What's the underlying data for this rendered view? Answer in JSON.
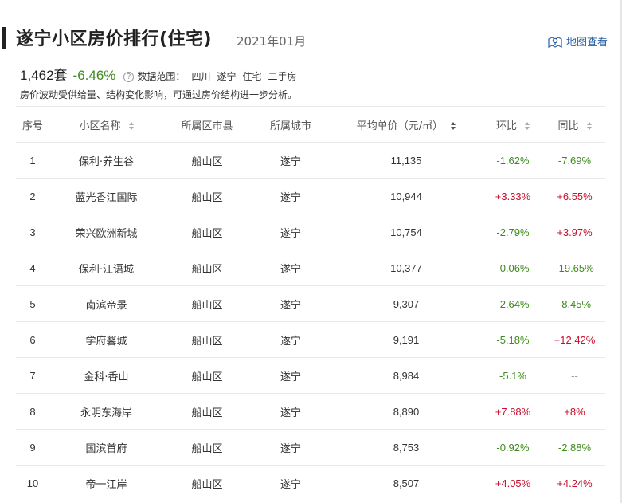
{
  "header": {
    "title": "遂宁小区房价排行(住宅)",
    "date": "2021年01月",
    "map_link": "地图查看"
  },
  "summary": {
    "count": "1,462套",
    "change": "-6.46%",
    "help_icon": "?",
    "scope_label": "数据范围：",
    "scope_items": [
      "四川",
      "遂宁",
      "住宅",
      "二手房"
    ],
    "note": "房价波动受供给量、结构变化影响，可通过房价结构进一步分析。"
  },
  "table": {
    "columns": [
      "序号",
      "小区名称",
      "所属区市县",
      "所属城市",
      "平均单价（元/㎡）",
      "环比",
      "同比"
    ],
    "rows": [
      {
        "rank": "1",
        "name": "保利·养生谷",
        "district": "船山区",
        "city": "遂宁",
        "price": "11,135",
        "mom": "-1.62%",
        "yoy": "-7.69%"
      },
      {
        "rank": "2",
        "name": "蓝光香江国际",
        "district": "船山区",
        "city": "遂宁",
        "price": "10,944",
        "mom": "+3.33%",
        "yoy": "+6.55%"
      },
      {
        "rank": "3",
        "name": "荣兴欧洲新城",
        "district": "船山区",
        "city": "遂宁",
        "price": "10,754",
        "mom": "-2.79%",
        "yoy": "+3.97%"
      },
      {
        "rank": "4",
        "name": "保利·江语城",
        "district": "船山区",
        "city": "遂宁",
        "price": "10,377",
        "mom": "-0.06%",
        "yoy": "-19.65%"
      },
      {
        "rank": "5",
        "name": "南滨帝景",
        "district": "船山区",
        "city": "遂宁",
        "price": "9,307",
        "mom": "-2.64%",
        "yoy": "-8.45%"
      },
      {
        "rank": "6",
        "name": "学府馨城",
        "district": "船山区",
        "city": "遂宁",
        "price": "9,191",
        "mom": "-5.18%",
        "yoy": "+12.42%"
      },
      {
        "rank": "7",
        "name": "金科·香山",
        "district": "船山区",
        "city": "遂宁",
        "price": "8,984",
        "mom": "-5.1%",
        "yoy": "--"
      },
      {
        "rank": "8",
        "name": "永明东海岸",
        "district": "船山区",
        "city": "遂宁",
        "price": "8,890",
        "mom": "+7.88%",
        "yoy": "+8%"
      },
      {
        "rank": "9",
        "name": "国滨首府",
        "district": "船山区",
        "city": "遂宁",
        "price": "8,753",
        "mom": "-0.92%",
        "yoy": "-2.88%"
      },
      {
        "rank": "10",
        "name": "帝一江岸",
        "district": "船山区",
        "city": "遂宁",
        "price": "8,507",
        "mom": "+4.05%",
        "yoy": "+4.24%"
      }
    ]
  },
  "colors": {
    "positive": "#c8102e",
    "negative": "#3f8a1e",
    "link": "#2a62a8"
  },
  "icons": {
    "map": "map-pin-icon",
    "sort": "sort-arrows-icon",
    "help": "help-circle-icon"
  }
}
